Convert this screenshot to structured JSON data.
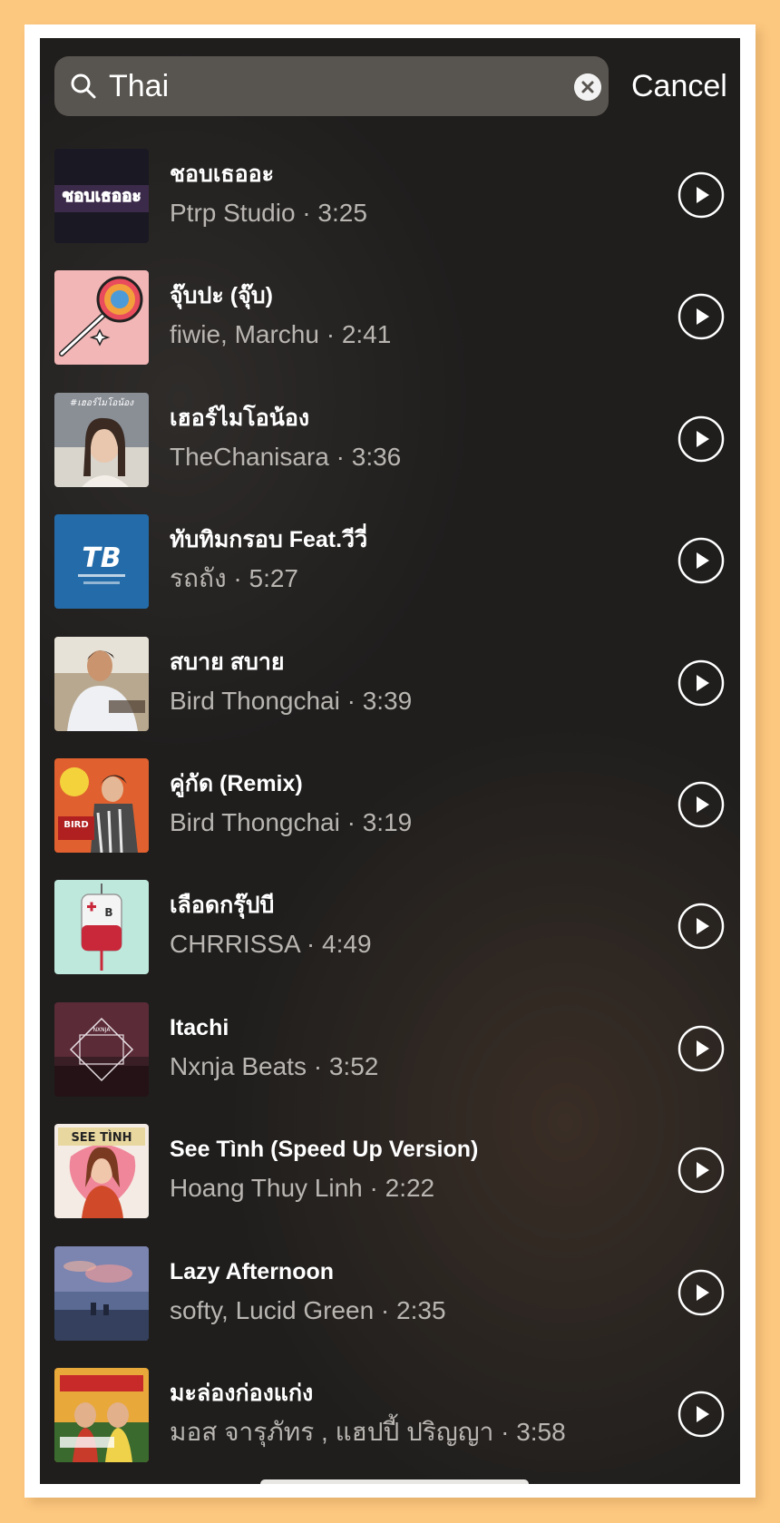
{
  "search": {
    "query": "Thai",
    "cancel_label": "Cancel"
  },
  "colors": {
    "page_background": "#fcc77f",
    "screen_background": "#1f1e1d",
    "search_box": "#58544f",
    "title_text": "#ffffff",
    "subtitle_text": "#b9b6b2"
  },
  "icons": {
    "search": "search-icon",
    "clear": "clear-icon",
    "play": "play-icon"
  },
  "tracks": [
    {
      "title": "ชอบเธออะ",
      "subtitle": "Ptrp Studio · 3:25",
      "cover_label": "ชอบเธออะ"
    },
    {
      "title": "จุ๊บปะ (จุ๊บ)",
      "subtitle": "fiwie, Marchu · 2:41"
    },
    {
      "title": "เฮอร์ไมโอน้อง",
      "subtitle": "TheChanisara · 3:36",
      "cover_label": "#เฮอร์ไมโอน้อง"
    },
    {
      "title": "ทับทิมกรอบ Feat.วีวี่",
      "subtitle": "รถถัง · 5:27",
      "cover_label": "TB"
    },
    {
      "title": "สบาย สบาย",
      "subtitle": "Bird Thongchai · 3:39"
    },
    {
      "title": "คู่กัด (Remix)",
      "subtitle": "Bird Thongchai · 3:19",
      "cover_label": "BIRD"
    },
    {
      "title": "เลือดกรุ๊ปบี",
      "subtitle": "CHRRISSA · 4:49",
      "cover_label": "B"
    },
    {
      "title": "Itachi",
      "subtitle": "Nxnja Beats · 3:52",
      "cover_label": "NXNJA"
    },
    {
      "title": "See Tình (Speed Up Version)",
      "subtitle": "Hoang Thuy Linh · 2:22",
      "cover_label": "SEE TÌNH"
    },
    {
      "title": "Lazy Afternoon",
      "subtitle": "softy, Lucid Green · 2:35"
    },
    {
      "title": "มะล่องก่องแก่ง",
      "subtitle": "มอส จารุภัทร , แฮปปี้ ปริญญา · 3:58"
    }
  ]
}
